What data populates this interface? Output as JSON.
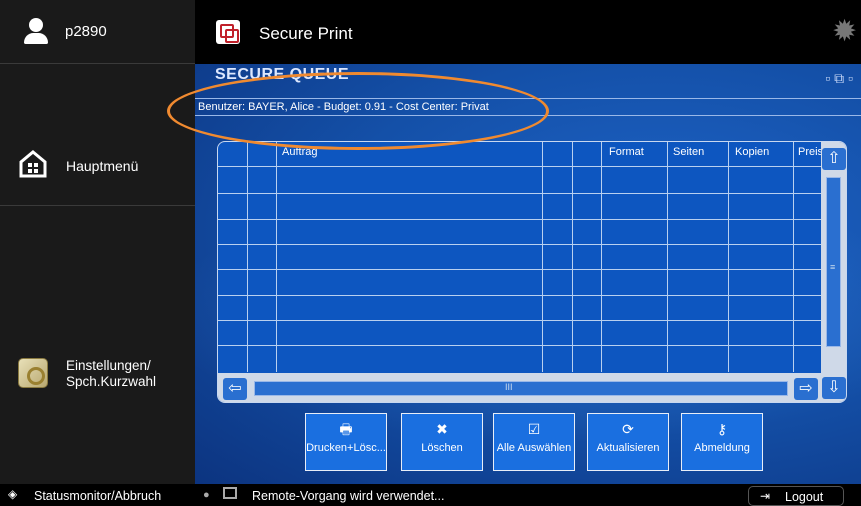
{
  "sidebar": {
    "user": "p2890",
    "home": "Hauptmenü",
    "settings_line1": "Einstellungen/",
    "settings_line2": "Spch.Kurzwahl"
  },
  "header": {
    "title": "Secure Print"
  },
  "queue": {
    "title": "SECURE QUEUE",
    "info": "Benutzer: BAYER, Alice - Budget: 0.91 - Cost Center: Privat",
    "columns": [
      "Auftrag",
      "Format",
      "Seiten",
      "Kopien",
      "Preis"
    ]
  },
  "actions": [
    {
      "label": "Drucken+Lösc..."
    },
    {
      "label": "Löschen"
    },
    {
      "label": "Alle Auswählen"
    },
    {
      "label": "Aktualisieren"
    },
    {
      "label": "Abmeldung"
    }
  ],
  "status": {
    "monitor": "Statusmonitor/Abbruch",
    "remote": "Remote-Vorgang wird verwendet...",
    "logout": "Logout"
  },
  "colors": {
    "accent_blue": "#1a6fe0",
    "annotation": "#f08a30"
  }
}
